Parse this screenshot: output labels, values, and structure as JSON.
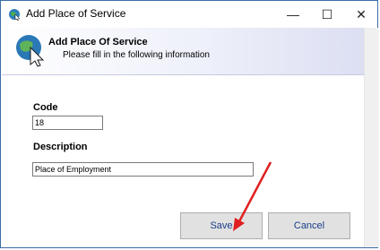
{
  "window": {
    "title": "Add Place of Service"
  },
  "controls": {
    "minimize": "—",
    "maximize": "☐",
    "close": "✕"
  },
  "header": {
    "title": "Add Place Of Service",
    "subtitle": "Please fill in the following information"
  },
  "form": {
    "code_label": "Code",
    "code_value": "18",
    "description_label": "Description",
    "description_value": "Place of Employment"
  },
  "buttons": {
    "save": "Save",
    "cancel": "Cancel"
  },
  "colors": {
    "annotation_arrow": "#e02020",
    "button_text": "#1a3f8a"
  },
  "icons": [
    "globe-cursor-icon",
    "globe-cursor-large-icon"
  ]
}
